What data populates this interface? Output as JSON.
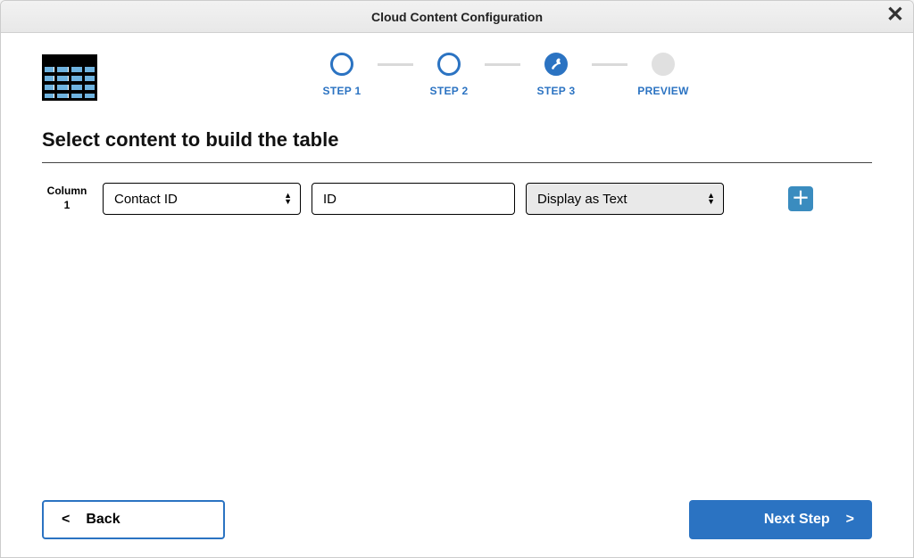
{
  "window": {
    "title": "Cloud Content Configuration"
  },
  "stepper": {
    "steps": [
      {
        "label": "STEP 1"
      },
      {
        "label": "STEP 2"
      },
      {
        "label": "STEP 3"
      },
      {
        "label": "PREVIEW"
      }
    ],
    "current_index": 2
  },
  "section": {
    "title": "Select content to build the table"
  },
  "columns": [
    {
      "label_line1": "Column",
      "label_line2": "1",
      "source_field": "Contact ID",
      "display_name": "ID",
      "format": "Display as Text"
    }
  ],
  "buttons": {
    "back_arrow": "<",
    "back_label": "Back",
    "next_label": "Next Step",
    "next_arrow": ">"
  },
  "colors": {
    "primary": "#2b73c2",
    "accent": "#3a8cbf"
  }
}
